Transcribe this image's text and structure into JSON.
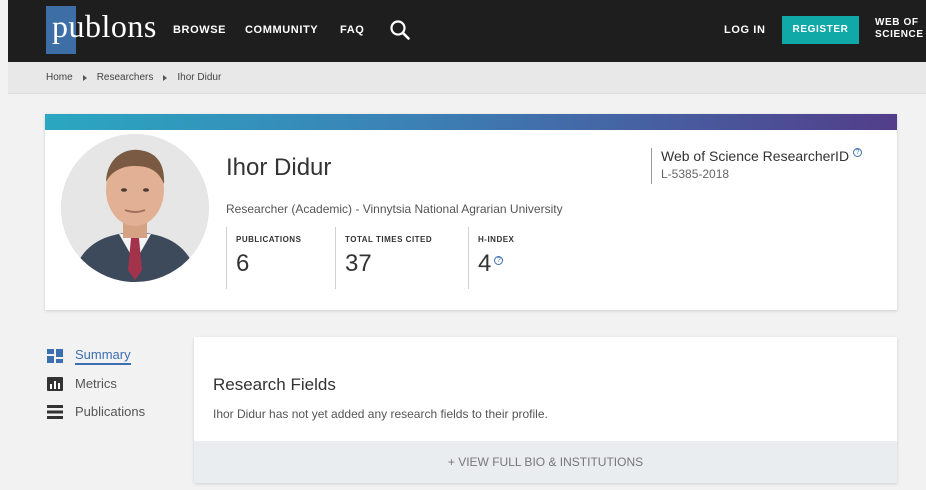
{
  "nav": {
    "logo": "publons",
    "links": [
      "BROWSE",
      "COMMUNITY",
      "FAQ"
    ],
    "login": "LOG IN",
    "register": "REGISTER",
    "wos_line1": "WEB OF",
    "wos_line2": "SCIENCE"
  },
  "breadcrumb": [
    "Home",
    "Researchers",
    "Ihor Didur"
  ],
  "profile": {
    "name": "Ihor Didur",
    "affiliation": "Researcher (Academic) - Vinnytsia National Agrarian University",
    "stats": [
      {
        "label": "PUBLICATIONS",
        "value": "6"
      },
      {
        "label": "TOTAL TIMES CITED",
        "value": "37"
      },
      {
        "label": "H-INDEX",
        "value": "4"
      }
    ],
    "researcher_id_title": "Web of Science ResearcherID",
    "researcher_id": "L-5385-2018"
  },
  "sidebar": {
    "items": [
      {
        "label": "Summary",
        "icon": "dashboard-icon"
      },
      {
        "label": "Metrics",
        "icon": "bar-chart-icon"
      },
      {
        "label": "Publications",
        "icon": "list-icon"
      }
    ]
  },
  "research": {
    "title": "Research Fields",
    "text": "Ihor Didur has not yet added any research fields to their profile.",
    "footer": "+ VIEW FULL BIO & INSTITUTIONS"
  },
  "colors": {
    "topbar": "#1e1e1e",
    "accent": "#11a8a8",
    "link": "#3b6fb0"
  }
}
